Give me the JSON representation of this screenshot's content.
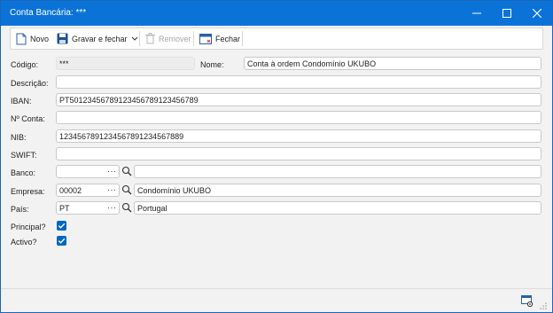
{
  "window": {
    "title": "Conta Bancária: ***"
  },
  "toolbar": {
    "novo": "Novo",
    "gravar": "Gravar e fechar",
    "remover": "Remover",
    "fechar": "Fechar"
  },
  "form": {
    "codigo_label": "Código:",
    "codigo_value": "***",
    "nome_label": "Nome:",
    "nome_value": "Conta à ordem Condomínio UKUBO",
    "descricao_label": "Descrição:",
    "descricao_value": "",
    "iban_label": "IBAN:",
    "iban_value": "PT50123456789123456789123456789",
    "nconta_label": "Nº Conta:",
    "nconta_value": "",
    "nib_label": "NIB:",
    "nib_value": "1234567891234567891234567889",
    "swift_label": "SWIFT:",
    "swift_value": "",
    "banco_label": "Banco:",
    "banco_code": "",
    "banco_name": "",
    "empresa_label": "Empresa:",
    "empresa_code": "00002",
    "empresa_name": "Condomínio UKUBO",
    "pais_label": "País:",
    "pais_code": "PT",
    "pais_name": "Portugal",
    "principal_label": "Principal?",
    "principal_checked": true,
    "activo_label": "Activo?",
    "activo_checked": true,
    "lookup_dots": "···"
  },
  "colors": {
    "titlebar": "#0b73d8",
    "accent": "#0067c0"
  },
  "icons": [
    "document-icon",
    "save-icon",
    "trash-icon",
    "close-window-icon",
    "minimize-icon",
    "maximize-icon",
    "close-icon",
    "search-icon",
    "settings-window-icon"
  ]
}
